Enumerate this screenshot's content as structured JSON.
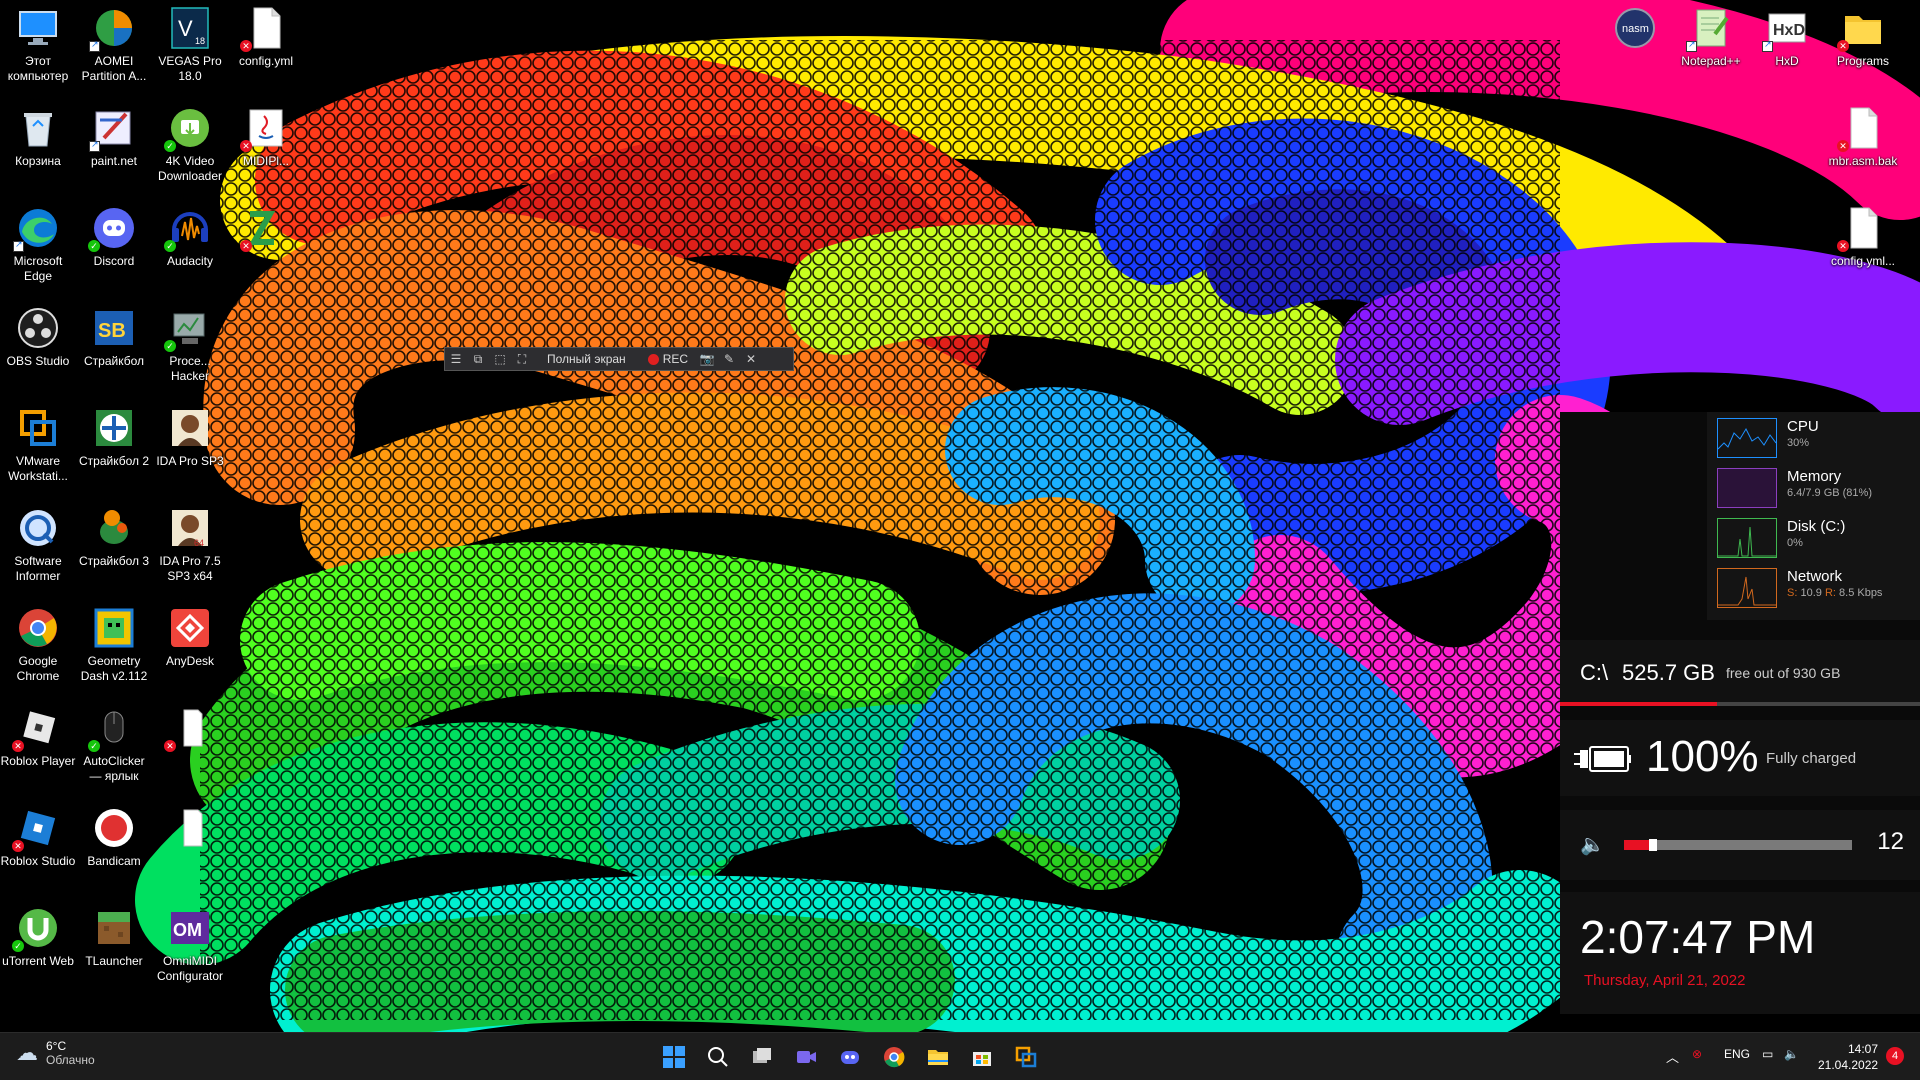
{
  "desktop": {
    "icons": [
      {
        "label": "Этот компьютер"
      },
      {
        "label": "AOMEI Partition A..."
      },
      {
        "label": "VEGAS Pro 18.0"
      },
      {
        "label": "config.yml"
      },
      {
        "label": "Корзина"
      },
      {
        "label": "paint.net"
      },
      {
        "label": "4K Video Downloader"
      },
      {
        "label": "MIDIPl..."
      },
      {
        "label": "Microsoft Edge"
      },
      {
        "label": "Discord"
      },
      {
        "label": "Audacity"
      },
      {
        "label": "OBS Studio"
      },
      {
        "label": "Страйкбол"
      },
      {
        "label": "Proce... Hacker"
      },
      {
        "label": "VMware Workstati..."
      },
      {
        "label": "Страйкбол 2"
      },
      {
        "label": "IDA Pro SP3"
      },
      {
        "label": "Software Informer"
      },
      {
        "label": "Страйкбол 3"
      },
      {
        "label": "IDA Pro 7.5 SP3 x64"
      },
      {
        "label": "Google Chrome"
      },
      {
        "label": "Geometry Dash v2.112"
      },
      {
        "label": "AnyDesk"
      },
      {
        "label": "Roblox Player"
      },
      {
        "label": "AutoClicker — ярлык"
      },
      {
        "label": "Roblox Studio"
      },
      {
        "label": "Bandicam"
      },
      {
        "label": "uTorrent Web"
      },
      {
        "label": "TLauncher"
      },
      {
        "label": "OmniMIDI Configurator"
      },
      {
        "label": "Notepad++"
      },
      {
        "label": "HxD"
      },
      {
        "label": "Programs"
      },
      {
        "label": "mbr.asm.bak"
      },
      {
        "label": "config.yml..."
      }
    ]
  },
  "rec_toolbar": {
    "mode_label": "Полный экран",
    "rec_label": "REC"
  },
  "monitor": {
    "cpu": {
      "title": "CPU",
      "value": "30%",
      "color": "#1e90ff"
    },
    "memory": {
      "title": "Memory",
      "value": "6.4/7.9 GB (81%)",
      "color": "#8b3fbf"
    },
    "disk": {
      "title": "Disk (C:)",
      "value": "0%",
      "color": "#3fb950"
    },
    "network": {
      "title": "Network",
      "send_label": "S:",
      "send_value": "10.9",
      "recv_label": "R:",
      "recv_value": "8.5 Kbps",
      "color": "#d2691e"
    }
  },
  "drive": {
    "label": "C:\\",
    "free": "525.7 GB",
    "suffix": "free out of 930 GB",
    "used_fraction": 0.435
  },
  "battery": {
    "percent": "100%",
    "status": "Fully charged"
  },
  "volume": {
    "level": "12",
    "fraction": 0.12
  },
  "clock": {
    "time": "2:07:47 PM",
    "date": "Thursday, April 21, 2022"
  },
  "taskbar": {
    "weather_temp": "6°C",
    "weather_desc": "Облачно",
    "lang": "ENG",
    "time": "14:07",
    "date": "21.04.2022",
    "notification_count": "4"
  },
  "colors": {
    "accent_red": "#e81123",
    "panel_bg": "#111111",
    "taskbar_bg": "#1c1c1c"
  }
}
